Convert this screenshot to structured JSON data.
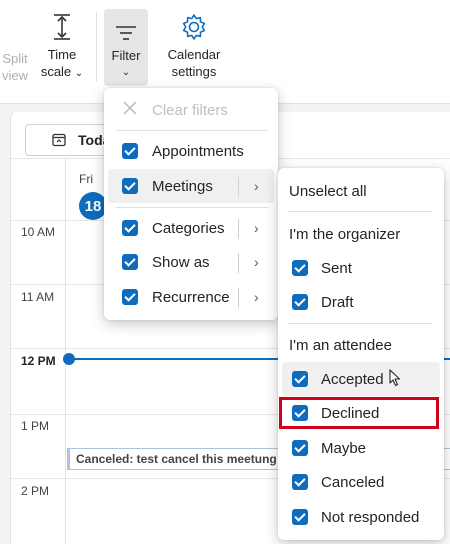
{
  "ribbon": {
    "split_view": [
      "Split",
      "view"
    ],
    "time_scale": [
      "Time",
      "scale"
    ],
    "filter": "Filter",
    "calendar_settings": [
      "Calendar",
      "settings"
    ]
  },
  "calendar": {
    "today_button": "Today",
    "day_name": "Fri",
    "day_number": "18",
    "times": [
      "10 AM",
      "11 AM",
      "12 PM",
      "1 PM",
      "2 PM"
    ],
    "event_title": "Canceled: test cancel this meetung"
  },
  "filter_menu": {
    "clear_filters": "Clear filters",
    "items": [
      {
        "label": "Appointments",
        "checked": true,
        "submenu": false
      },
      {
        "label": "Meetings",
        "checked": true,
        "submenu": true
      },
      {
        "label": "Categories",
        "checked": true,
        "submenu": true
      },
      {
        "label": "Show as",
        "checked": true,
        "submenu": true
      },
      {
        "label": "Recurrence",
        "checked": true,
        "submenu": true
      }
    ]
  },
  "meetings_submenu": {
    "unselect_all": "Unselect all",
    "organizer_header": "I'm the organizer",
    "organizer_items": [
      "Sent",
      "Draft"
    ],
    "attendee_header": "I'm an attendee",
    "attendee_items": [
      "Accepted",
      "Declined",
      "Maybe",
      "Canceled",
      "Not responded"
    ]
  },
  "colors": {
    "accent": "#0f6cbd",
    "highlight": "#d0021b"
  }
}
